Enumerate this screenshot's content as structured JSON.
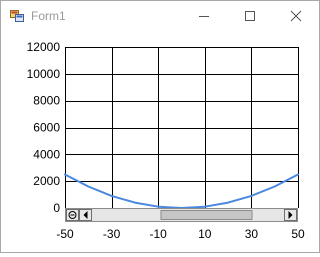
{
  "window": {
    "title": "Form1",
    "icons": [
      "app-icon",
      "minimize-icon",
      "maximize-icon",
      "close-icon"
    ]
  },
  "chart_data": {
    "type": "line",
    "x_ticks": [
      "-50",
      "-30",
      "-10",
      "10",
      "30",
      "50"
    ],
    "y_ticks": [
      "0",
      "2000",
      "4000",
      "6000",
      "8000",
      "10000",
      "12000"
    ],
    "xlim": [
      -50,
      50
    ],
    "ylim": [
      0,
      12000
    ],
    "grid": true,
    "series": [
      {
        "color": "#4a88e0",
        "x": [
          -50,
          -40,
          -30,
          -20,
          -10,
          0,
          10,
          20,
          30,
          40,
          50
        ],
        "y": [
          2500,
          1600,
          900,
          400,
          100,
          0,
          100,
          400,
          900,
          1600,
          2500
        ]
      }
    ],
    "scrollbar": {
      "visible": true,
      "thumb_start": 0.25,
      "thumb_end": 0.75
    }
  }
}
